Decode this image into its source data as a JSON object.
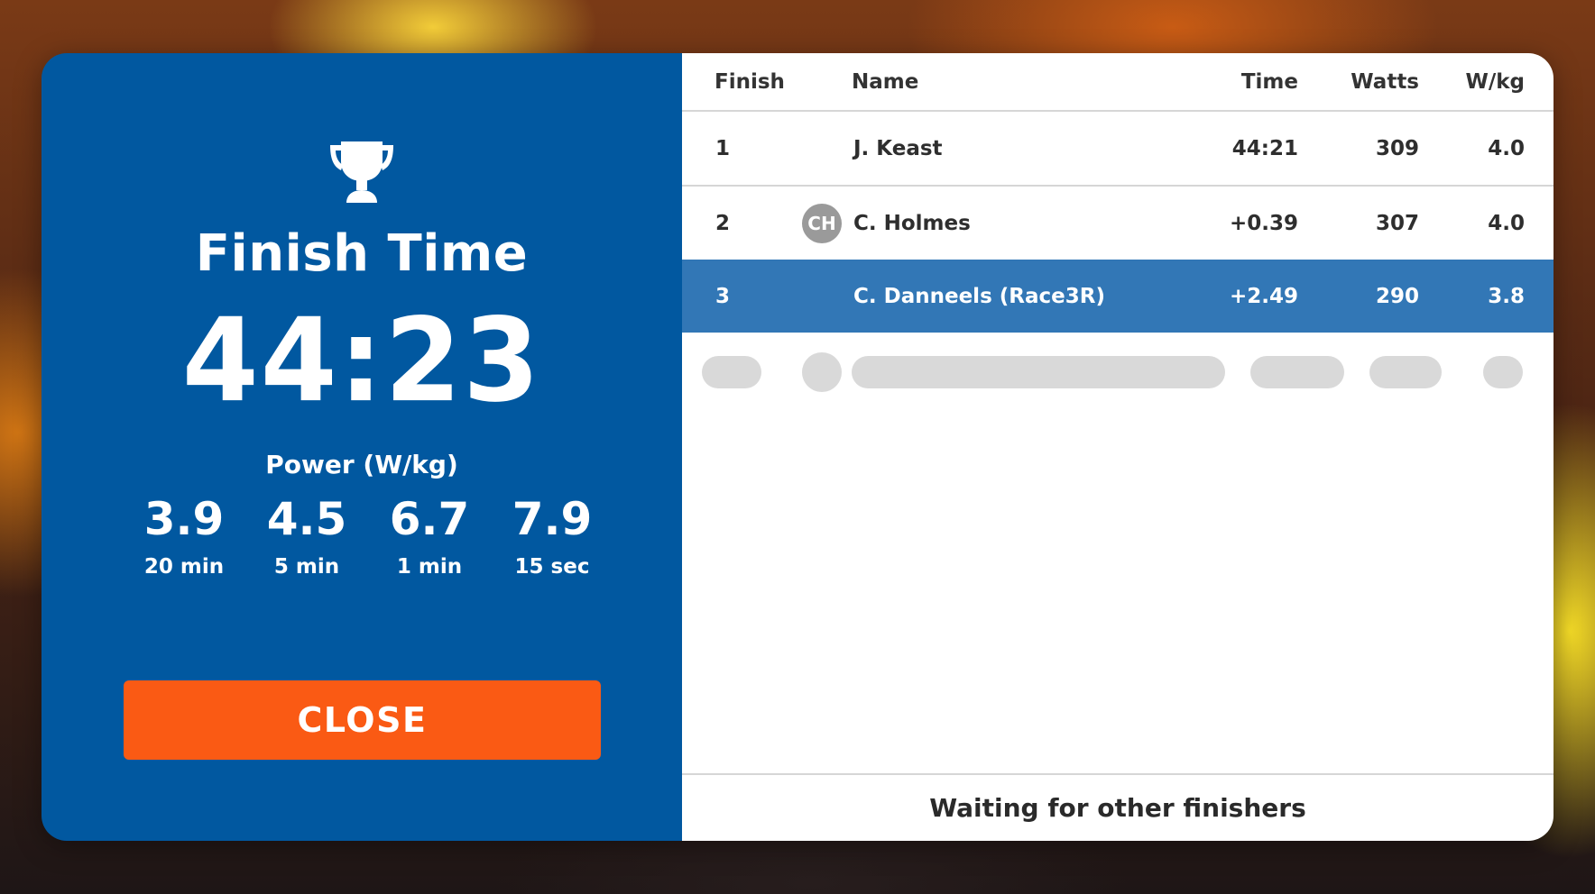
{
  "summary": {
    "trophy_icon": "trophy-icon",
    "title": "Finish Time",
    "time": "44:23",
    "power_title": "Power (W/kg)",
    "power": [
      {
        "value": "3.9",
        "label": "20 min"
      },
      {
        "value": "4.5",
        "label": "5 min"
      },
      {
        "value": "6.7",
        "label": "1 min"
      },
      {
        "value": "7.9",
        "label": "15 sec"
      }
    ],
    "close_label": "CLOSE"
  },
  "results": {
    "columns": {
      "finish": "Finish",
      "name": "Name",
      "time": "Time",
      "watts": "Watts",
      "wkg": "W/kg"
    },
    "rows": [
      {
        "finish": "1",
        "avatar": "",
        "name": "J. Keast",
        "time": "44:21",
        "watts": "309",
        "wkg": "4.0"
      },
      {
        "finish": "2",
        "avatar": "CH",
        "name": "C. Holmes",
        "time": "+0.39",
        "watts": "307",
        "wkg": "4.0"
      },
      {
        "finish": "3",
        "avatar": "",
        "name": "C. Danneels (Race3R)",
        "time": "+2.49",
        "watts": "290",
        "wkg": "3.8"
      }
    ],
    "footer": "Waiting for other finishers"
  },
  "colors": {
    "panel_blue": "#0158a0",
    "highlight_blue": "#3277b6",
    "close_orange": "#fa5a14"
  }
}
